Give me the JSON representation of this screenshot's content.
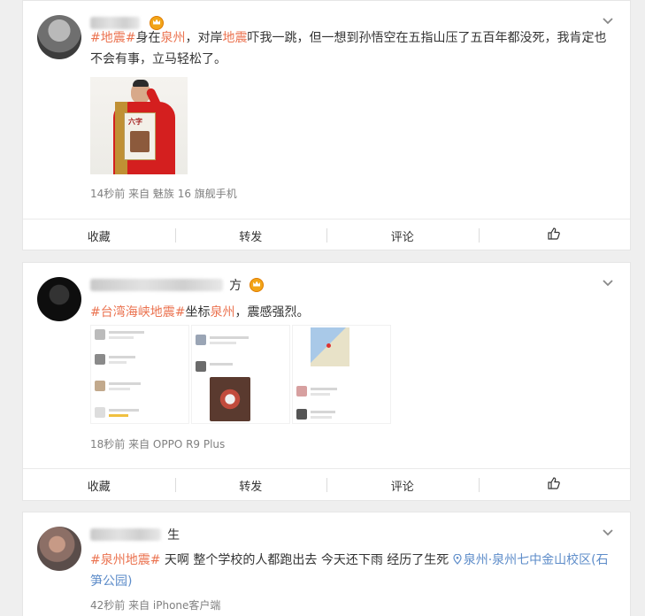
{
  "posts": [
    {
      "user_suffix": "",
      "text": {
        "t1": "#地震#",
        "t2": "身在",
        "t3": "泉州",
        "t4": "，对岸",
        "t5": "地震",
        "t6": "吓我一跳，但一想到孙悟空在五指山压了五百年都没死，我肯定也不会有事，立马轻松了。"
      },
      "book_label": "六字",
      "meta": "14秒前 来自 魅族 16 旗舰手机"
    },
    {
      "user_suffix": "方",
      "text": {
        "t1": "#台湾海峡",
        "t2": "地震",
        "t3": "#",
        "t4": "坐标",
        "t5": "泉州",
        "t6": "，震感强烈。"
      },
      "meta": "18秒前 来自 OPPO R9 Plus"
    },
    {
      "user_suffix": "生",
      "text": {
        "t1": "#泉州地震#",
        "t2": " 天啊 整个学校的人都跑出去 今天还下雨 经历了生死 ",
        "t3": "泉州·泉州七中金山校区(石笋公园)"
      },
      "meta": "42秒前 来自 iPhone客户端"
    }
  ],
  "actions": {
    "collect": "收藏",
    "repost": "转发",
    "comment": "评论"
  },
  "colors": {
    "topic": "#eb7350",
    "location": "#5d8cc9",
    "crown": "#f2a518"
  }
}
